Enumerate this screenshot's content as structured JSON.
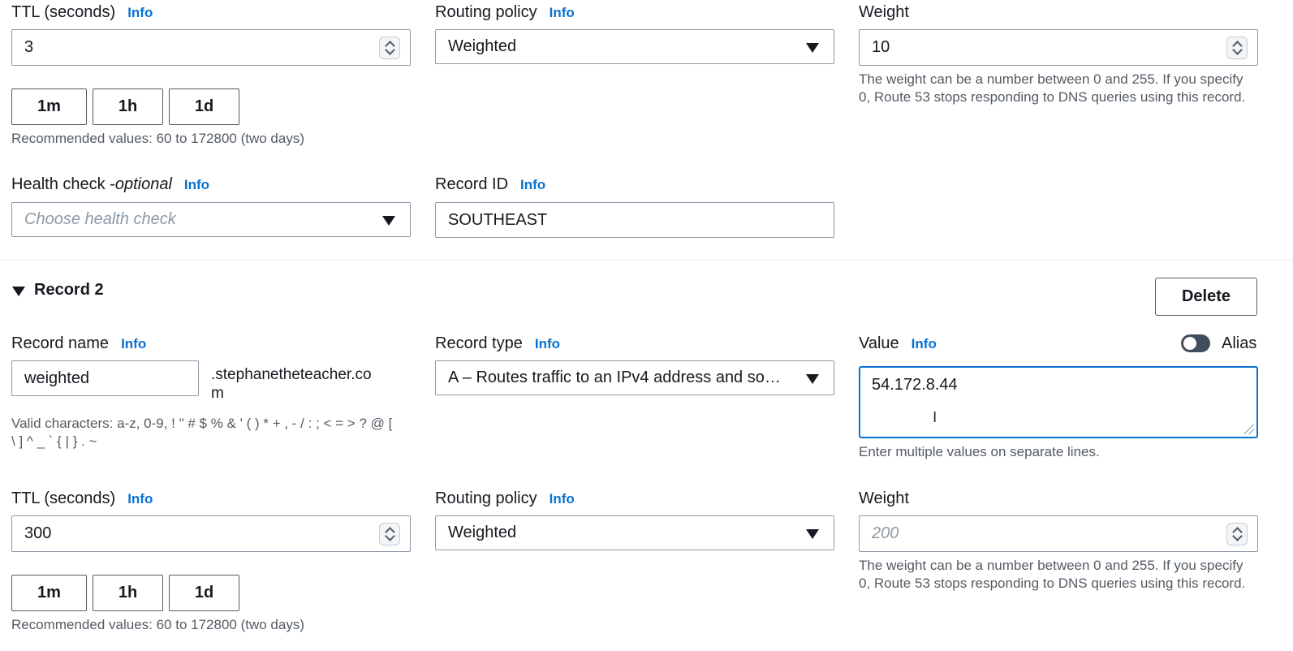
{
  "record1": {
    "ttl": {
      "label": "TTL (seconds)",
      "info": "Info",
      "value": "3"
    },
    "routing_policy": {
      "label": "Routing policy",
      "info": "Info",
      "value": "Weighted"
    },
    "weight": {
      "label": "Weight",
      "value": "10",
      "hint": "The weight can be a number between 0 and 255. If you specify 0, Route 53 stops responding to DNS queries using this record."
    },
    "ttl_buttons": [
      "1m",
      "1h",
      "1d"
    ],
    "ttl_hint": "Recommended values: 60 to 172800 (two days)",
    "health_check": {
      "label": "Health check - ",
      "label_optional": "optional",
      "info": "Info",
      "placeholder": "Choose health check"
    },
    "record_id": {
      "label": "Record ID",
      "info": "Info",
      "value": "SOUTHEAST"
    }
  },
  "record2": {
    "title": "Record 2",
    "delete_label": "Delete",
    "record_name": {
      "label": "Record name",
      "info": "Info",
      "value": "weighted",
      "domain_line1": ".stephanetheteacher.co",
      "domain_line2": "m",
      "hint_line1": "Valid characters: a-z, 0-9, ! \" # $ % & ' ( ) * + , - / : ; < = > ? @ [",
      "hint_line2": "\\ ] ^ _ ` { | } . ~"
    },
    "record_type": {
      "label": "Record type",
      "info": "Info",
      "value": "A – Routes traffic to an IPv4 address and so…"
    },
    "value": {
      "label": "Value",
      "info": "Info",
      "alias_label": "Alias",
      "text": "54.172.8.44",
      "hint": "Enter multiple values on separate lines."
    },
    "ttl": {
      "label": "TTL (seconds)",
      "info": "Info",
      "value": "300"
    },
    "routing_policy": {
      "label": "Routing policy",
      "info": "Info",
      "value": "Weighted"
    },
    "weight": {
      "label": "Weight",
      "placeholder": "200",
      "hint": "The weight can be a number between 0 and 255. If you specify 0, Route 53 stops responding to DNS queries using this record."
    },
    "ttl_buttons": [
      "1m",
      "1h",
      "1d"
    ],
    "ttl_hint": "Recommended values: 60 to 172800 (two days)"
  },
  "icons": {
    "cursor": "text-cursor-icon",
    "caret": "caret-down-icon",
    "spinner": "number-spinner-icon",
    "toggle": "alias-toggle-icon"
  },
  "colors": {
    "link": "#0972d3",
    "text": "#16191f",
    "muted": "#545b64",
    "focus": "#0972d3"
  }
}
